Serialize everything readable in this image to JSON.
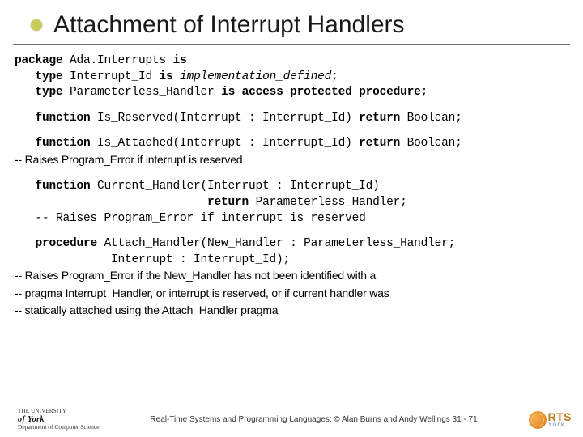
{
  "title": "Attachment of Interrupt Handlers",
  "code": {
    "l1a": "package",
    "l1b": " Ada.Interrupts ",
    "l1c": "is",
    "l2a": "   type",
    "l2b": " Interrupt_Id ",
    "l2c": "is",
    "l2d": " implementation_defined",
    "l2e": ";",
    "l3a": "   type",
    "l3b": " Parameterless_Handler ",
    "l3c": "is access protected procedure",
    "l3d": ";",
    "l4a": "   function",
    "l4b": " Is_Reserved(Interrupt : Interrupt_Id) ",
    "l4c": "return",
    "l4d": " Boolean;",
    "l5a": "   function",
    "l5b": " Is_Attached(Interrupt : Interrupt_Id) ",
    "l5c": "return",
    "l5d": " Boolean;",
    "l5e": "            -- Raises Program_Error if interrupt is reserved",
    "l6a": "   function",
    "l6b": " Current_Handler(Interrupt : Interrupt_Id)",
    "l6c": "                            ",
    "l6d": "return",
    "l6e": " Parameterless_Handler;",
    "l6f": "   -- Raises Program_Error if interrupt is reserved",
    "l7a": "   procedure",
    "l7b": " Attach_Handler(New_Handler : Parameterless_Handler;",
    "l7c": "              Interrupt : Interrupt_Id);",
    "l7d": "     -- Raises Program_Error if the New_Handler has not been identified with a",
    "l7e": "     -- pragma Interrupt_Handler, or interrupt is reserved, or  if current handler was",
    "l7f": "     -- statically attached using the Attach_Handler pragma"
  },
  "footer": {
    "uni_top": "THE UNIVERSITY",
    "uni_mid": "of York",
    "uni_bot": "Department of Computer Science",
    "center": "Real-Time Systems and Programming Languages: © Alan Burns and Andy Wellings  31 - 71",
    "rts_main": "RTS",
    "rts_sub": "York"
  }
}
